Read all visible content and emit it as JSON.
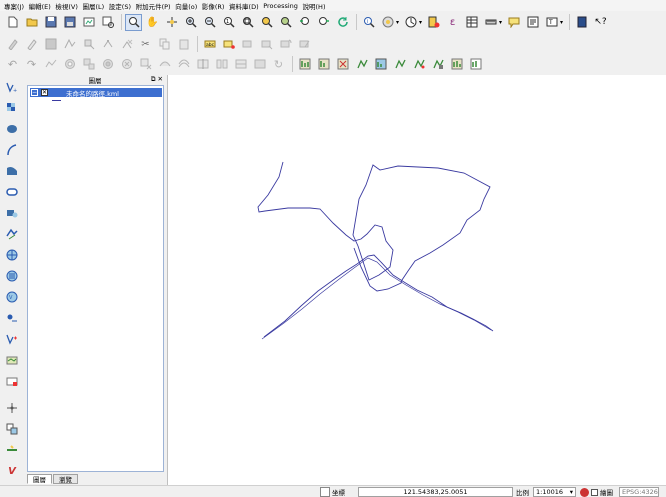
{
  "menu": [
    "專案(J)",
    "編輯(E)",
    "檢視(V)",
    "圖層(L)",
    "設定(S)",
    "附加元件(P)",
    "向量(o)",
    "影像(R)",
    "資料庫(D)",
    "Processing",
    "說明(H)"
  ],
  "icons": {
    "toolbar1": [
      "new-project-icon",
      "open-project-icon",
      "save-project-icon",
      "save-as-icon",
      "new-print-composer-icon",
      "composer-manager-icon",
      "touch-zoom-icon",
      "pan-icon",
      "pan-to-selection-icon",
      "zoom-in-icon",
      "zoom-out-icon",
      "zoom-actual-size-icon",
      "zoom-full-icon",
      "zoom-to-selection-icon",
      "zoom-to-layer-icon",
      "zoom-last-icon",
      "zoom-next-icon",
      "refresh-icon",
      "identify-icon",
      "select-icon",
      "deselect-icon",
      "field-calculator-icon",
      "open-attribute-table-icon",
      "measure-icon",
      "map-tips-icon",
      "new-bookmark-icon",
      "text-annotation-icon",
      "help-icon",
      "whats-this-icon"
    ],
    "toolbar2": [
      "current-edits-icon",
      "toggle-editing-icon",
      "save-edits-icon",
      "add-feature-icon",
      "move-feature-icon",
      "node-tool-icon",
      "delete-selected-icon",
      "cut-features-icon",
      "copy-features-icon",
      "paste-features-icon",
      "label-icon",
      "pin-labels-icon",
      "highlight-pinned-labels-icon",
      "move-label-icon",
      "rotate-label-icon",
      "change-label-icon"
    ],
    "toolbar3": [
      "undo-icon",
      "redo-icon",
      "simplify-icon",
      "add-ring-icon",
      "add-part-icon",
      "fill-ring-icon",
      "delete-ring-icon",
      "delete-part-icon",
      "reshape-icon",
      "offset-curve-icon",
      "split-features-icon",
      "split-parts-icon",
      "merge-attributes-icon",
      "merge-features-icon",
      "rotate-symbols-icon",
      "grass-mapset-icon",
      "grass-new-mapset-icon",
      "grass-close-mapset-icon",
      "grass-add-vector-icon",
      "grass-add-raster-icon",
      "grass-new-vector-icon",
      "grass-edit-vector-icon",
      "grass-tools-icon",
      "grass-region-icon",
      "grass-edit-region-icon"
    ],
    "left": [
      "add-vector-layer-icon",
      "add-raster-layer-icon",
      "add-postgis-layer-icon",
      "add-spatialite-layer-icon",
      "add-mssql-layer-icon",
      "add-oracle-layer-icon",
      "add-wms-layer-icon",
      "add-wcs-layer-icon",
      "add-wfs-layer-icon",
      "add-delimited-text-icon",
      "add-gpx-icon",
      "new-shapefile-icon",
      "new-spatialite-icon",
      "new-temporary-layer-icon",
      "remove-layer-icon",
      "gps-icon",
      "coordinate-capture-icon",
      "georeferencer-icon",
      "plugin-icon",
      "python-console-icon"
    ]
  },
  "layers_panel": {
    "title": "圖層",
    "layer_name": "未命名的路徑.kml",
    "tabs": [
      "圖層",
      "瀏覽"
    ]
  },
  "map": {
    "line_color": "#3a3aa0"
  },
  "status": {
    "coord_label": "坐標",
    "coordinate": "121.54383,25.0051",
    "scale_label": "比例",
    "scale": "1:10016",
    "render_label": "繪圖",
    "crs": "EPSG:4326"
  }
}
